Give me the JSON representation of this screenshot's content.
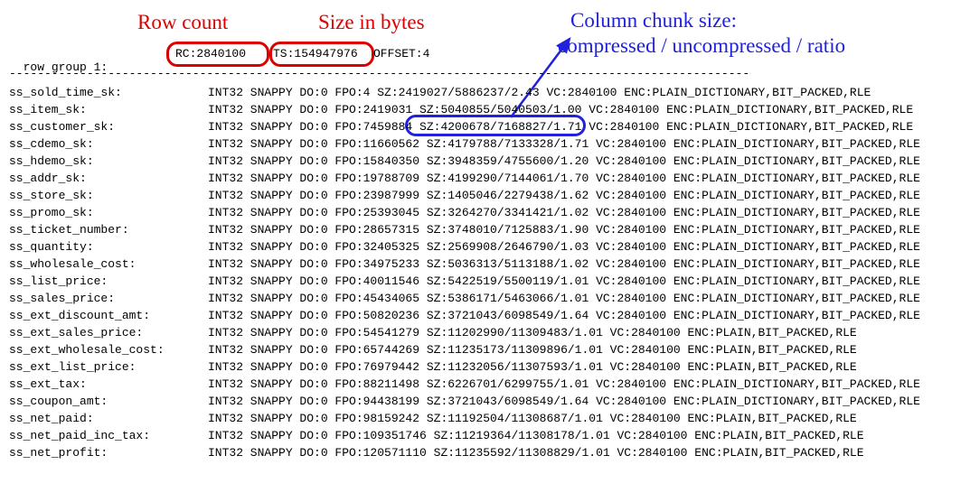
{
  "annotations": {
    "row_count_label": "Row count",
    "size_label": "Size in bytes",
    "chunk_label_l1": "Column chunk size:",
    "chunk_label_l2": "compressed / uncompressed / ratio"
  },
  "row_group": {
    "label": "row group 1:",
    "rc": "RC:2840100",
    "ts": "TS:154947976",
    "offset": "OFFSET:4"
  },
  "separator": "---------------------------------------------------------------------------------------------------------",
  "columns": [
    {
      "name": "ss_sold_time_sk:",
      "rest": "INT32 SNAPPY DO:0 FPO:4 SZ:2419027/5886237/2.43 VC:2840100 ENC:PLAIN_DICTIONARY,BIT_PACKED,RLE"
    },
    {
      "name": "ss_item_sk:",
      "rest": "INT32 SNAPPY DO:0 FPO:2419031 SZ:5040855/5040503/1.00 VC:2840100 ENC:PLAIN_DICTIONARY,BIT_PACKED,RLE"
    },
    {
      "name": "ss_customer_sk:",
      "rest": "INT32 SNAPPY DO:0 FPO:7459884 SZ:4200678/7168827/1.71 VC:2840100 ENC:PLAIN_DICTIONARY,BIT_PACKED,RLE"
    },
    {
      "name": "ss_cdemo_sk:",
      "rest": "INT32 SNAPPY DO:0 FPO:11660562 SZ:4179788/7133328/1.71 VC:2840100 ENC:PLAIN_DICTIONARY,BIT_PACKED,RLE"
    },
    {
      "name": "ss_hdemo_sk:",
      "rest": "INT32 SNAPPY DO:0 FPO:15840350 SZ:3948359/4755600/1.20 VC:2840100 ENC:PLAIN_DICTIONARY,BIT_PACKED,RLE"
    },
    {
      "name": "ss_addr_sk:",
      "rest": "INT32 SNAPPY DO:0 FPO:19788709 SZ:4199290/7144061/1.70 VC:2840100 ENC:PLAIN_DICTIONARY,BIT_PACKED,RLE"
    },
    {
      "name": "ss_store_sk:",
      "rest": "INT32 SNAPPY DO:0 FPO:23987999 SZ:1405046/2279438/1.62 VC:2840100 ENC:PLAIN_DICTIONARY,BIT_PACKED,RLE"
    },
    {
      "name": "ss_promo_sk:",
      "rest": "INT32 SNAPPY DO:0 FPO:25393045 SZ:3264270/3341421/1.02 VC:2840100 ENC:PLAIN_DICTIONARY,BIT_PACKED,RLE"
    },
    {
      "name": "ss_ticket_number:",
      "rest": "INT32 SNAPPY DO:0 FPO:28657315 SZ:3748010/7125883/1.90 VC:2840100 ENC:PLAIN_DICTIONARY,BIT_PACKED,RLE"
    },
    {
      "name": "ss_quantity:",
      "rest": "INT32 SNAPPY DO:0 FPO:32405325 SZ:2569908/2646790/1.03 VC:2840100 ENC:PLAIN_DICTIONARY,BIT_PACKED,RLE"
    },
    {
      "name": "ss_wholesale_cost:",
      "rest": "INT32 SNAPPY DO:0 FPO:34975233 SZ:5036313/5113188/1.02 VC:2840100 ENC:PLAIN_DICTIONARY,BIT_PACKED,RLE"
    },
    {
      "name": "ss_list_price:",
      "rest": "INT32 SNAPPY DO:0 FPO:40011546 SZ:5422519/5500119/1.01 VC:2840100 ENC:PLAIN_DICTIONARY,BIT_PACKED,RLE"
    },
    {
      "name": "ss_sales_price:",
      "rest": "INT32 SNAPPY DO:0 FPO:45434065 SZ:5386171/5463066/1.01 VC:2840100 ENC:PLAIN_DICTIONARY,BIT_PACKED,RLE"
    },
    {
      "name": "ss_ext_discount_amt:",
      "rest": "INT32 SNAPPY DO:0 FPO:50820236 SZ:3721043/6098549/1.64 VC:2840100 ENC:PLAIN_DICTIONARY,BIT_PACKED,RLE"
    },
    {
      "name": "ss_ext_sales_price:",
      "rest": "INT32 SNAPPY DO:0 FPO:54541279 SZ:11202990/11309483/1.01 VC:2840100 ENC:PLAIN,BIT_PACKED,RLE"
    },
    {
      "name": "ss_ext_wholesale_cost:",
      "rest": "INT32 SNAPPY DO:0 FPO:65744269 SZ:11235173/11309896/1.01 VC:2840100 ENC:PLAIN,BIT_PACKED,RLE"
    },
    {
      "name": "ss_ext_list_price:",
      "rest": "INT32 SNAPPY DO:0 FPO:76979442 SZ:11232056/11307593/1.01 VC:2840100 ENC:PLAIN,BIT_PACKED,RLE"
    },
    {
      "name": "ss_ext_tax:",
      "rest": "INT32 SNAPPY DO:0 FPO:88211498 SZ:6226701/6299755/1.01 VC:2840100 ENC:PLAIN_DICTIONARY,BIT_PACKED,RLE"
    },
    {
      "name": "ss_coupon_amt:",
      "rest": "INT32 SNAPPY DO:0 FPO:94438199 SZ:3721043/6098549/1.64 VC:2840100 ENC:PLAIN_DICTIONARY,BIT_PACKED,RLE"
    },
    {
      "name": "ss_net_paid:",
      "rest": "INT32 SNAPPY DO:0 FPO:98159242 SZ:11192504/11308687/1.01 VC:2840100 ENC:PLAIN,BIT_PACKED,RLE"
    },
    {
      "name": "ss_net_paid_inc_tax:",
      "rest": "INT32 SNAPPY DO:0 FPO:109351746 SZ:11219364/11308178/1.01 VC:2840100 ENC:PLAIN,BIT_PACKED,RLE"
    },
    {
      "name": "ss_net_profit:",
      "rest": "INT32 SNAPPY DO:0 FPO:120571110 SZ:11235592/11308829/1.01 VC:2840100 ENC:PLAIN,BIT_PACKED,RLE"
    }
  ]
}
